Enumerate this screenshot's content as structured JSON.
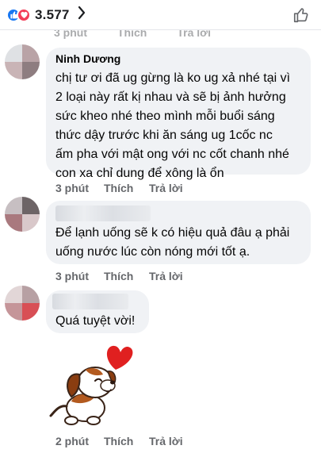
{
  "header": {
    "reaction_count": "3.577"
  },
  "ghost_meta": {
    "time": "3 phút",
    "like": "Thích",
    "reply": "Trả lời"
  },
  "comments": [
    {
      "author": "Ninh Dương",
      "text_lines": [
        "chị tư ơi đã ug gừng là ko ug xả nhé tại vì",
        "2 loại này rất kị nhau và sẽ bị ảnh hưởng",
        "sức kheo nhé theo mình mỗi buổi sáng",
        "thức dậy trước khi ăn sáng ug 1cốc nc",
        "ấm pha với mật ong với nc cốt chanh nhé",
        "con xa chỉ dung để xông là ổn"
      ],
      "time": "3 phút",
      "like": "Thích",
      "reply": "Trả lời"
    },
    {
      "text_lines": [
        "Để lạnh uống sẽ k có hiệu quả đâu ạ phải",
        "uống nước lúc còn nóng mới tốt ạ."
      ],
      "time": "3 phút",
      "like": "Thích",
      "reply": "Trả lời"
    },
    {
      "text_lines": [
        "Quá tuyệt vời!"
      ],
      "sticker": "puppy-heart-sticker",
      "time": "2 phút",
      "like": "Thích",
      "reply": "Trả lời"
    }
  ],
  "colors": {
    "like_blue": "#1877f2",
    "love_red": "#f33e58",
    "bubble": "#f0f2f5",
    "meta_gray": "#65676b"
  }
}
